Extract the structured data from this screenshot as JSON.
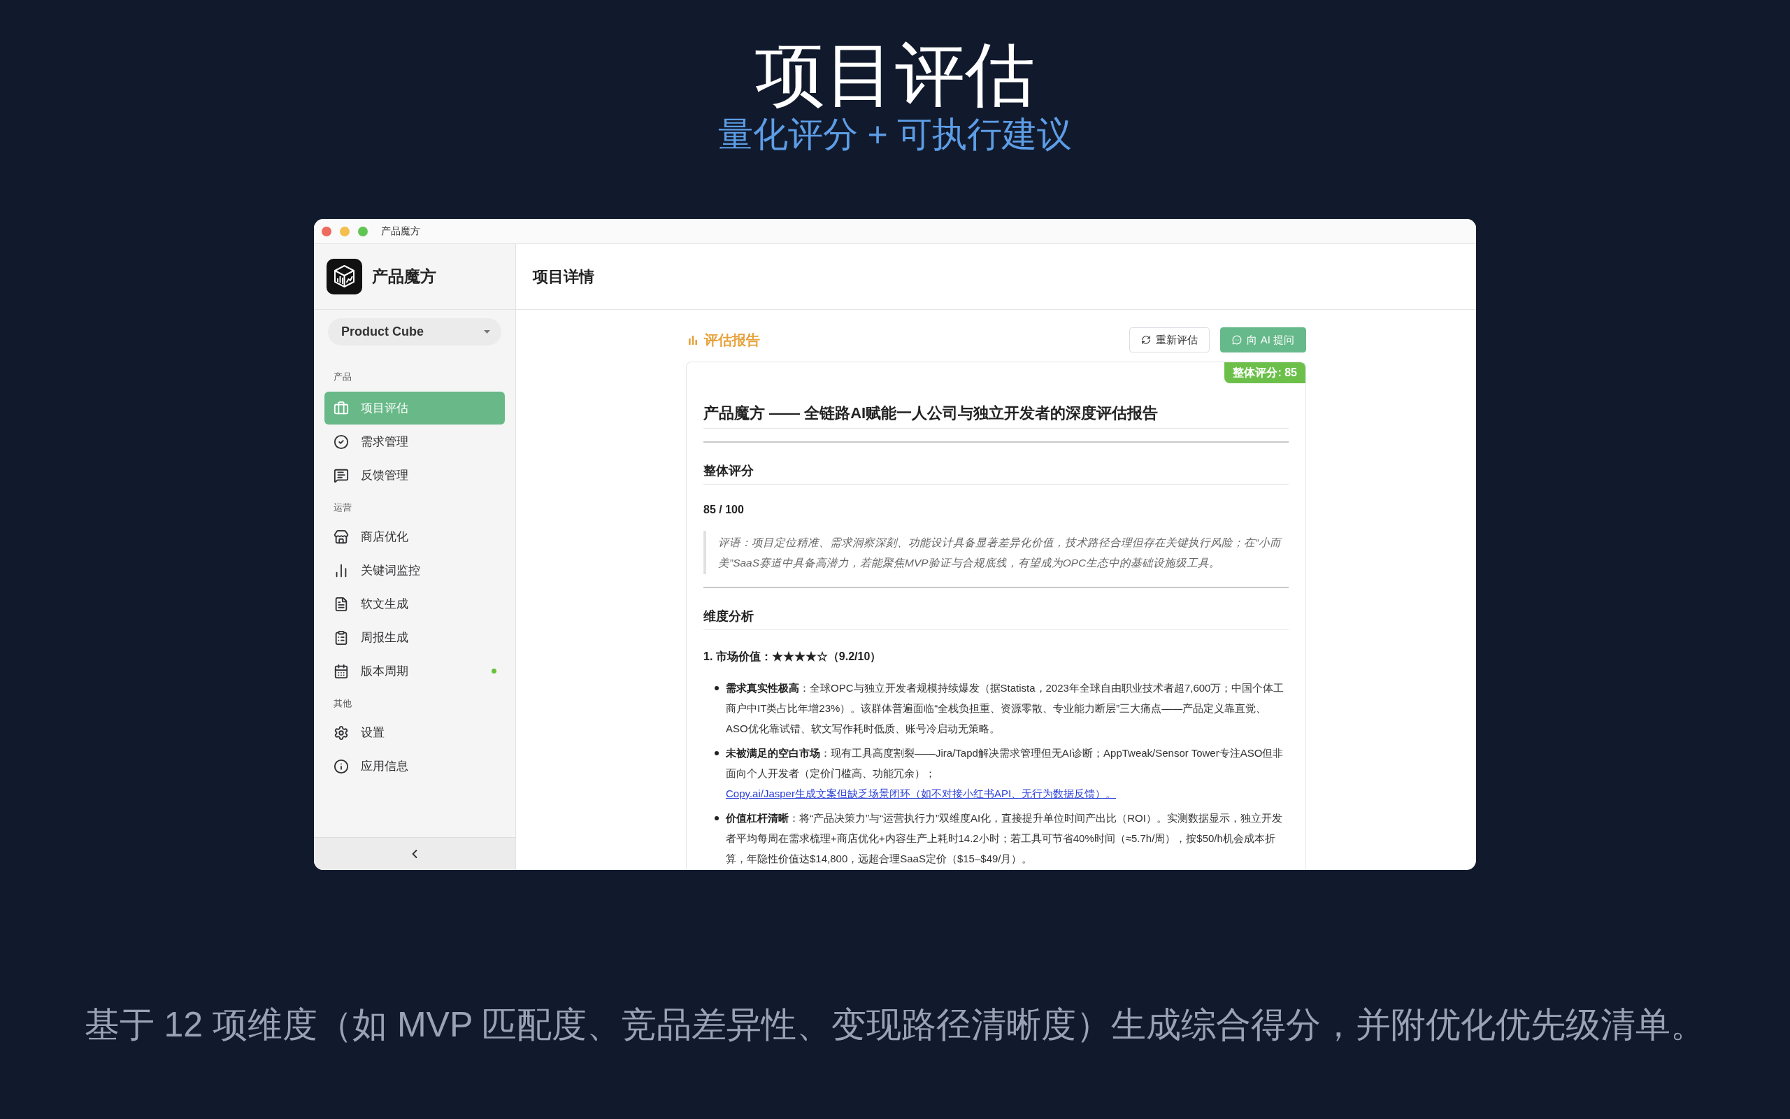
{
  "header": {
    "title": "项目评估",
    "subtitle": "量化评分 + 可执行建议"
  },
  "window": {
    "title": "产品魔方"
  },
  "sidebar": {
    "app_name": "产品魔方",
    "project_select": {
      "value": "Product Cube"
    },
    "sections": [
      {
        "label": "产品",
        "items": [
          {
            "label": "项目评估",
            "selected": true,
            "dot": false
          },
          {
            "label": "需求管理",
            "selected": false,
            "dot": false
          },
          {
            "label": "反馈管理",
            "selected": false,
            "dot": false
          }
        ]
      },
      {
        "label": "运营",
        "items": [
          {
            "label": "商店优化",
            "selected": false,
            "dot": false
          },
          {
            "label": "关键词监控",
            "selected": false,
            "dot": false
          },
          {
            "label": "软文生成",
            "selected": false,
            "dot": false
          },
          {
            "label": "周报生成",
            "selected": false,
            "dot": false
          },
          {
            "label": "版本周期",
            "selected": false,
            "dot": true
          }
        ]
      },
      {
        "label": "其他",
        "items": [
          {
            "label": "设置",
            "selected": false,
            "dot": false
          },
          {
            "label": "应用信息",
            "selected": false,
            "dot": false
          }
        ]
      }
    ]
  },
  "main": {
    "title": "项目详情",
    "report": {
      "title": "评估报告",
      "buttons": [
        {
          "label": "重新评估",
          "kind": "outline"
        },
        {
          "label": "向 AI 提问",
          "kind": "primary"
        }
      ],
      "score_badge": "整体评分: 85",
      "document": [
        {
          "kind": "h1",
          "text": "产品魔方 —— 全链路AI赋能一人公司与独立开发者的深度评估报告"
        },
        {
          "kind": "rule"
        },
        {
          "kind": "h2",
          "text": "整体评分"
        },
        {
          "kind": "score",
          "text": "85 / 100"
        },
        {
          "kind": "quote",
          "text": "评语：项目定位精准、需求洞察深刻、功能设计具备显著差异化价值，技术路径合理但存在关键执行风险；在“小而美”SaaS赛道中具备高潜力，若能聚焦MVP验证与合规底线，有望成为OPC生态中的基础设施级工具。"
        },
        {
          "kind": "rule"
        },
        {
          "kind": "h2",
          "text": "维度分析"
        },
        {
          "kind": "h3",
          "text": "1. 市场价值：★★★★☆（9.2/10）"
        },
        {
          "kind": "list",
          "items": [
            {
              "text": "**需求真实性极高**：全球OPC与独立开发者规模持续爆发（据Statista，2023年全球自由职业技术者超7,600万；中国个体工商户中IT类占比年增23%）。该群体普遍面临“全栈负担重、资源零散、专业能力断层”三大痛点——产品定义靠直觉、ASO优化靠试错、软文写作耗时低质、账号冷启动无策略。"
            },
            {
              "text": "**未被满足的空白市场**：现有工具高度割裂——Jira/Tapd解决需求管理但无AI诊断；AppTweak/Sensor Tower专注ASO但非面向个人开发者（定价门槛高、功能冗余）；",
              "link": "Copy.ai/Jasper生成文案但缺乏场景闭环（如不对接小红书API、无行为数据反馈）。"
            },
            {
              "text": "**价值杠杆清晰**：将“产品决策力”与“运营执行力”双维度AI化，直接提升单位时间产出比（ROI）。实测数据显示，独立开发者平均每周在需求梳理+商店优化+内容生产上耗时14.2小时；若工具可节省40%时间（≈5.7h/周），按$50/h机会成本折算，年隐性价值达$14,800，远超合理SaaS定价（$15–$49/月）。"
            }
          ]
        }
      ]
    }
  },
  "caption": "基于 12 项维度（如 MVP 匹配度、竞品差异性、变现路径清晰度）生成综合得分，并附优化优先级清单。"
}
